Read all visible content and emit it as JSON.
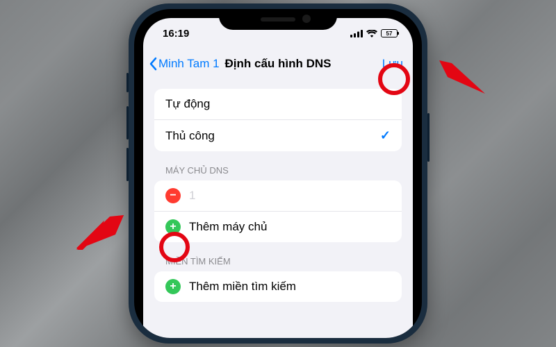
{
  "status": {
    "time": "16:19",
    "battery": "57"
  },
  "nav": {
    "back_label": "Minh Tam 1",
    "title": "Định cấu hình DNS",
    "save_label": "Lưu"
  },
  "mode": {
    "auto_label": "Tự động",
    "manual_label": "Thủ công"
  },
  "dns": {
    "header": "MÁY CHỦ DNS",
    "existing_value": "1",
    "add_label": "Thêm máy chủ"
  },
  "search": {
    "header": "MIỀN TÌM KIẾM",
    "add_label": "Thêm miền tìm kiếm"
  }
}
